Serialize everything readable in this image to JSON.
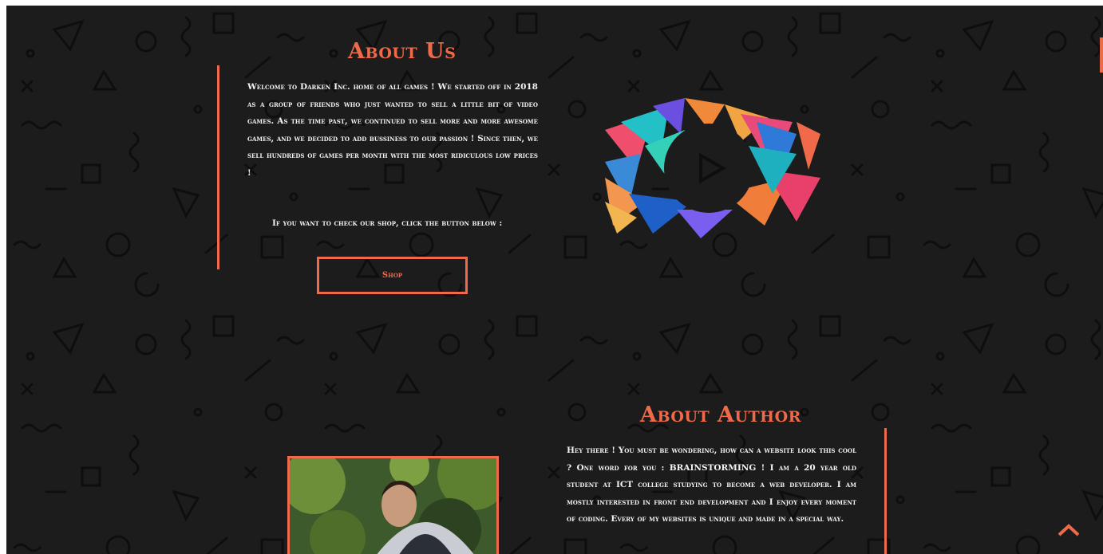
{
  "about_us": {
    "title": "About Us",
    "paragraph": "Welcome to Darken Inc. home of all games ! We started off in 2018 as a group of friends who just wanted to sell a little bit of video games. As the time past, we continued to sell more and more awesome games, and we decided to add bussiness to our passion ! Since then, we sell hundreds of games per month with the most ridiculous low prices !",
    "cta_text": "If you want to check our shop, click the button below :",
    "shop_button": "Shop"
  },
  "about_author": {
    "title": "About Author",
    "paragraph": "Hey there ! You must be wondering, how can a website look this cool ? One word for you : BRAINSTORMING ! I am a 20 year old student at ICT college studying to become a web developer. I am mostly interested in front end development and I enjoy every moment of coding. Every of my websites is unique and made in a special way."
  },
  "icons": {
    "logo": "low-poly-play-logo",
    "scroll_top": "chevron-up-icon"
  },
  "colors": {
    "accent": "#ef6a4a",
    "background": "#1c1c1c",
    "text": "#f3f3f3"
  }
}
